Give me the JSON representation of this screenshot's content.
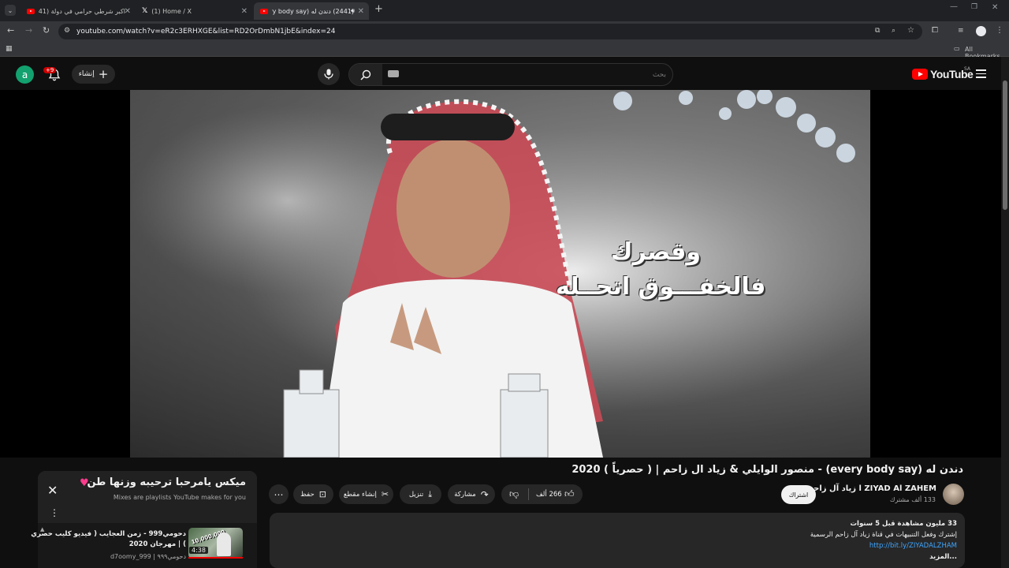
{
  "browser": {
    "tabs": [
      {
        "title": "اكبر شرطي حرامي في دولة (2441)",
        "favicon": "youtube-icon"
      },
      {
        "title": "(1) Home / X",
        "favicon": "x-icon"
      },
      {
        "title": "(2441) دندن له (every body say)",
        "favicon": "youtube-icon"
      }
    ],
    "url": "youtube.com/watch?v=eR2c3ERHXGE&list=RD2OrDmbN1jbE&index=24",
    "bookmarks_label": "All Bookmarks"
  },
  "masthead": {
    "search_placeholder": "بحث",
    "create_label": "إنشاء",
    "notification_count": "+9",
    "avatar_letter": "a",
    "logo_text": "YouTube",
    "country_code": "SA"
  },
  "video": {
    "overlay_line1": "وقصرك",
    "overlay_line2": "فالخفـــوق اتحــله",
    "title": "دندن له (every body say) - منصور الوايلي & زياد ال زاحم | ( حصرياً ) 2020",
    "channel_name": "زياد آل زاحم l ZIYAD Al ZAHEM",
    "subscribers": "133 ألف مشترك",
    "subscribe_label": "اشتراك",
    "likes": "266 ألف",
    "share_label": "مشاركة",
    "download_label": "تنزيل",
    "clip_label": "إنشاء مقطع",
    "save_label": "حفظ"
  },
  "description": {
    "stats": "33 مليون مشاهدة  قبل 5 سنوات",
    "line1": "إشترك وفعل التنبيهات في قناة زياد آل زاحم الرسمية",
    "link": "http://bit.ly/ZIYADALZHAM",
    "more": "...المزيد"
  },
  "mix": {
    "title": "ميكس يامرحبا ترحيبه وزنها طن",
    "subtitle": "Mixes are playlists YouTube makes for you",
    "item_title": "دحومي999 - زمن العجايب ( فيديو كليب حصري ) | مهرجان 2020",
    "item_channel": "d7oomy_999 | دحومي٩٩٩",
    "item_duration": "4:38",
    "item_thumb_text": "10,000,000"
  }
}
